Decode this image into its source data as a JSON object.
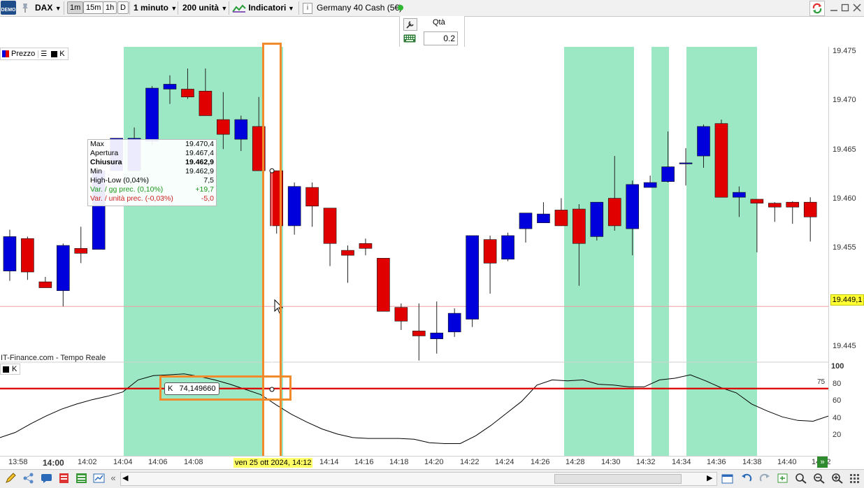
{
  "toolbar": {
    "logo": "DEMO",
    "instrument": "DAX",
    "timeframes": [
      "1m",
      "15m",
      "1h",
      "D"
    ],
    "interval": "1 minuto",
    "units": "200 unità",
    "indicators_label": "Indicatori",
    "market_name": "Germany 40 Cash (5€)",
    "market_status_color": "#2eb82e"
  },
  "order_panel": {
    "qty_label": "Qtà",
    "qty_value": "0.2"
  },
  "legend": {
    "price_label": "Prezzo",
    "k_label": "K"
  },
  "tooltip": {
    "rows": [
      {
        "label": "Max",
        "value": "19.470,4"
      },
      {
        "label": "Apertura",
        "value": "19.467,4"
      },
      {
        "label": "Chiusura",
        "value": "19.462,9"
      },
      {
        "label": "Min",
        "value": "19.462,9"
      },
      {
        "label": "High-Low (0,04%)",
        "value": "7,5"
      },
      {
        "label": "Var. / gg prec. (0,10%)",
        "value": "+19,7"
      },
      {
        "label": "Var. / unità prec. (-0,03%)",
        "value": "-5,0"
      }
    ]
  },
  "source_label": "IT-Finance.com - Tempo Reale",
  "k_panel": {
    "legend": "K",
    "tooltip": "K   74,149660",
    "level_label": "75",
    "y_ticks": [
      "100",
      "80",
      "60",
      "40",
      "20"
    ]
  },
  "price_axis": {
    "ticks": [
      "19.475",
      "19.470",
      "19.465",
      "19.460",
      "19.455",
      "19.450",
      "19.445"
    ],
    "current_price": "19.449,1"
  },
  "time_axis": {
    "ticks": [
      "13:58",
      "14:00",
      "14:02",
      "14:04",
      "14:06",
      "14:08",
      "14:14",
      "14:16",
      "14:18",
      "14:20",
      "14:22",
      "14:24",
      "14:26",
      "14:28",
      "14:30",
      "14:32",
      "14:34",
      "14:36",
      "14:38",
      "14:40",
      "14:42"
    ],
    "cursor_label": "ven 25 ott 2024, 14:12"
  },
  "colors": {
    "bull": "#0000dd",
    "bear": "#e00000",
    "highlight": "#9de8c4",
    "annotation": "#f08a2a",
    "level_line": "#dd0000"
  },
  "chart_data": {
    "type": "candlestick",
    "interval": "1 minute",
    "x": [
      "13:57",
      "13:58",
      "13:59",
      "14:00",
      "14:01",
      "14:02",
      "14:03",
      "14:04",
      "14:05",
      "14:06",
      "14:07",
      "14:08",
      "14:09",
      "14:10",
      "14:11",
      "14:12",
      "14:13",
      "14:14",
      "14:15",
      "14:16",
      "14:17",
      "14:18",
      "14:19",
      "14:20",
      "14:21",
      "14:22",
      "14:23",
      "14:24",
      "14:25",
      "14:26",
      "14:27",
      "14:28",
      "14:29",
      "14:30",
      "14:31",
      "14:32",
      "14:33",
      "14:34",
      "14:35",
      "14:36",
      "14:37",
      "14:38",
      "14:39",
      "14:40",
      "14:41",
      "14:42",
      "14:43"
    ],
    "candles": [
      {
        "o": 19.4522,
        "h": 19.4545,
        "l": 19.4503,
        "c": 19.4527
      },
      {
        "o": 19.4527,
        "h": 19.4569,
        "l": 19.4517,
        "c": 19.4562
      },
      {
        "o": 19.456,
        "h": 19.4562,
        "l": 19.4518,
        "c": 19.4526
      },
      {
        "o": 19.4516,
        "h": 19.4521,
        "l": 19.4512,
        "c": 19.451
      },
      {
        "o": 19.4507,
        "h": 19.4555,
        "l": 19.4491,
        "c": 19.4553
      },
      {
        "o": 19.455,
        "h": 19.4572,
        "l": 19.4535,
        "c": 19.4545
      },
      {
        "o": 19.4549,
        "h": 19.4605,
        "l": 19.4549,
        "c": 19.4629
      },
      {
        "o": 19.4629,
        "h": 19.465,
        "l": 19.4629,
        "c": 19.4662
      },
      {
        "o": 19.4629,
        "h": 19.4673,
        "l": 19.4629,
        "c": 19.4662
      },
      {
        "o": 19.4659,
        "h": 19.4715,
        "l": 19.4655,
        "c": 19.4713
      },
      {
        "o": 19.4712,
        "h": 19.4726,
        "l": 19.4697,
        "c": 19.4717
      },
      {
        "o": 19.4712,
        "h": 19.4733,
        "l": 19.4702,
        "c": 19.4704
      },
      {
        "o": 19.471,
        "h": 19.4733,
        "l": 19.4685,
        "c": 19.4685
      },
      {
        "o": 19.4681,
        "h": 19.4709,
        "l": 19.4651,
        "c": 19.4666
      },
      {
        "o": 19.4661,
        "h": 19.4685,
        "l": 19.4649,
        "c": 19.4681
      },
      {
        "o": 19.4674,
        "h": 19.4704,
        "l": 19.4629,
        "c": 19.4629
      },
      {
        "o": 19.4629,
        "h": 19.4629,
        "l": 19.4565,
        "c": 19.4573
      },
      {
        "o": 19.4573,
        "h": 19.4617,
        "l": 19.4564,
        "c": 19.4613
      },
      {
        "o": 19.4612,
        "h": 19.4617,
        "l": 19.4572,
        "c": 19.4593
      },
      {
        "o": 19.4591,
        "h": 19.4588,
        "l": 19.4532,
        "c": 19.4555
      },
      {
        "o": 19.4548,
        "h": 19.4553,
        "l": 19.4515,
        "c": 19.4543
      },
      {
        "o": 19.4555,
        "h": 19.456,
        "l": 19.4543,
        "c": 19.455
      },
      {
        "o": 19.454,
        "h": 19.454,
        "l": 19.4486,
        "c": 19.4486
      },
      {
        "o": 19.449,
        "h": 19.4494,
        "l": 19.4467,
        "c": 19.4476
      },
      {
        "o": 19.4466,
        "h": 19.4494,
        "l": 19.4436,
        "c": 19.4461
      },
      {
        "o": 19.4458,
        "h": 19.4496,
        "l": 19.4443,
        "c": 19.4464
      },
      {
        "o": 19.4465,
        "h": 19.4489,
        "l": 19.446,
        "c": 19.4484
      },
      {
        "o": 19.4478,
        "h": 19.4563,
        "l": 19.447,
        "c": 19.4563
      },
      {
        "o": 19.4559,
        "h": 19.4563,
        "l": 19.4504,
        "c": 19.4535
      },
      {
        "o": 19.4539,
        "h": 19.4566,
        "l": 19.4537,
        "c": 19.4563
      },
      {
        "o": 19.457,
        "h": 19.4586,
        "l": 19.4556,
        "c": 19.4586
      },
      {
        "o": 19.4576,
        "h": 19.4597,
        "l": 19.4576,
        "c": 19.4585
      },
      {
        "o": 19.4589,
        "h": 19.4601,
        "l": 19.4574,
        "c": 19.4573
      },
      {
        "o": 19.459,
        "h": 19.4595,
        "l": 19.4512,
        "c": 19.4555
      },
      {
        "o": 19.4562,
        "h": 19.4597,
        "l": 19.4558,
        "c": 19.4597
      },
      {
        "o": 19.4601,
        "h": 19.4644,
        "l": 19.4568,
        "c": 19.4573
      },
      {
        "o": 19.457,
        "h": 19.4619,
        "l": 19.4543,
        "c": 19.4615
      },
      {
        "o": 19.4612,
        "h": 19.4624,
        "l": 19.4613,
        "c": 19.4617
      },
      {
        "o": 19.4618,
        "h": 19.4669,
        "l": 19.4617,
        "c": 19.4633
      },
      {
        "o": 19.4637,
        "h": 19.4652,
        "l": 19.4614,
        "c": 19.4637
      },
      {
        "o": 19.4644,
        "h": 19.4676,
        "l": 19.4632,
        "c": 19.4674
      },
      {
        "o": 19.4677,
        "h": 19.4681,
        "l": 19.4602,
        "c": 19.4602
      },
      {
        "o": 19.4602,
        "h": 19.4613,
        "l": 19.4582,
        "c": 19.4607
      },
      {
        "o": 19.46,
        "h": 19.46,
        "l": 19.4546,
        "c": 19.4596
      },
      {
        "o": 19.4596,
        "h": 19.4597,
        "l": 19.4577,
        "c": 19.4592
      },
      {
        "o": 19.4597,
        "h": 19.4598,
        "l": 19.4575,
        "c": 19.4592
      },
      {
        "o": 19.4597,
        "h": 19.4602,
        "l": 19.4557,
        "c": 19.4582
      }
    ],
    "k_series": [
      18,
      24,
      34,
      43,
      51,
      57,
      62,
      66,
      71,
      85,
      90,
      91,
      92,
      89,
      85,
      80,
      74,
      68,
      56,
      45,
      36,
      28,
      22,
      18,
      17,
      17,
      17,
      16,
      12,
      11,
      11,
      20,
      32,
      46,
      60,
      79,
      85,
      84,
      85,
      80,
      79,
      77,
      77,
      85,
      87,
      91,
      84,
      76,
      70,
      57,
      49,
      42,
      38,
      37,
      43
    ],
    "y_axis": {
      "range": [
        19.4435,
        19.4755
      ],
      "ticks": [
        19.445,
        19.45,
        19.455,
        19.46,
        19.465,
        19.47,
        19.475
      ]
    },
    "k_axis": {
      "range": [
        0,
        100
      ],
      "ticks": [
        20,
        40,
        60,
        80,
        100
      ],
      "level": 75
    },
    "current_price": 19.4491
  }
}
